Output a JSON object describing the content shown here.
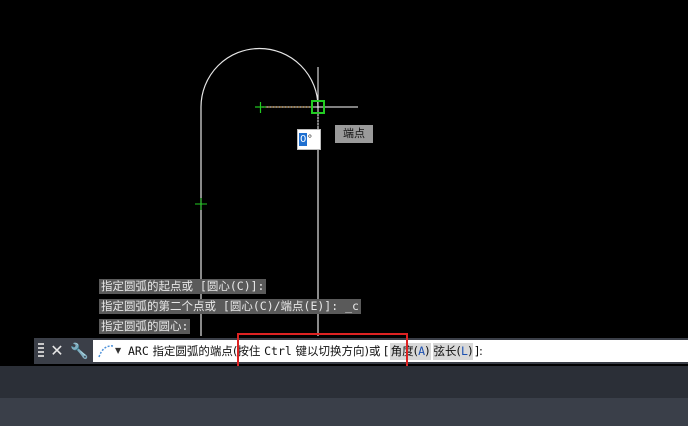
{
  "command_history": [
    "指定圆弧的起点或 [圆心(C)]:",
    "指定圆弧的第二个点或 [圆心(C)/端点(E)]: _c",
    "指定圆弧的圆心:"
  ],
  "osnap_tooltip": "端点",
  "angle_input": {
    "value": "0",
    "unit": "°"
  },
  "command_line": {
    "command": "ARC",
    "prompt_main": "指定圆弧的端点",
    "prompt_hint_open": "(按住 ",
    "prompt_hint_key": "Ctrl",
    "prompt_hint_close": " 键以切换方向)",
    "or_text": "或 [",
    "option_angle_label": "角度(",
    "option_angle_key": "A",
    "option_angle_close": ")",
    "option_chord_label": "弦长(",
    "option_chord_key": "L",
    "option_chord_close": ")",
    "tail": "]:"
  },
  "icons": {
    "grip": "grip-handle-icon",
    "close": "close-icon",
    "customize": "wrench-icon",
    "arc": "arc-command-icon"
  },
  "colors": {
    "drawing_background": "#000000",
    "geometry": "#ffffff",
    "osnap_marker": "#22cc22",
    "annotation_box": "#dd2222",
    "option_key": "#1a4fb0"
  }
}
